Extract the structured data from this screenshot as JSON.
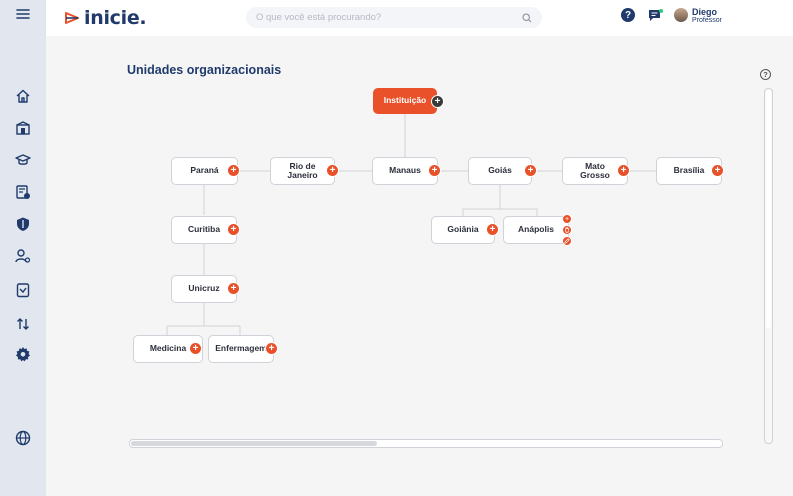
{
  "app": {
    "logo_text": "inicie.",
    "brand_color": "#1f3a6b",
    "accent_color": "#e8512a"
  },
  "topbar": {
    "search_placeholder": "O que você está procurando?",
    "help_label": "?",
    "user": {
      "name": "Diego",
      "role": "Professor"
    }
  },
  "sidebar": {
    "items": [
      {
        "icon": "menu-icon"
      },
      {
        "icon": "home-icon"
      },
      {
        "icon": "school-icon"
      },
      {
        "icon": "graduation-cap-icon"
      },
      {
        "icon": "calendar-settings-icon"
      },
      {
        "icon": "shield-icon"
      },
      {
        "icon": "user-settings-icon"
      },
      {
        "icon": "document-icon"
      },
      {
        "icon": "sort-arrows-icon"
      },
      {
        "icon": "gear-icon"
      },
      {
        "icon": "globe-icon"
      }
    ]
  },
  "main": {
    "title": "Unidades organizacionais",
    "help_label": "?"
  },
  "tree": {
    "root": "Instituição",
    "level1": [
      "Paraná",
      "Rio de\nJaneiro",
      "Manaus",
      "Goiás",
      "Mato\nGrosso",
      "Brasília"
    ],
    "parana_children": [
      "Curitiba"
    ],
    "curitiba_children": [
      "Unicruz"
    ],
    "unicruz_children": [
      "Medicina",
      "Enfermagem"
    ],
    "goias_children": [
      "Goiânia",
      "Anápolis"
    ],
    "add_symbol": "+"
  }
}
